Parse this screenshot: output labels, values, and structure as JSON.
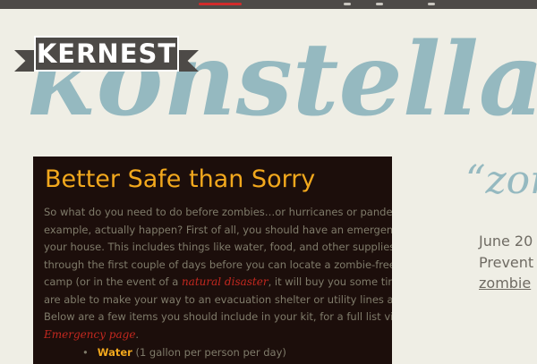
{
  "site": {
    "logo_text": "KERNEST",
    "script_title": "konstellation"
  },
  "post": {
    "title": "Better Safe than Sorry",
    "lines": [
      "So what do you need to do before zombies…or hurricanes or pander",
      "example, actually happen? First of all, you should have an emergen",
      "your house. This includes things like water, food, and other supplies",
      "through the first couple of days before you can locate a zombie-free",
      "camp (or in the event of a ",
      "are able to make your way to an evacuation shelter or utility lines are",
      "Below are a few items you should include in your kit, for a full list vis"
    ],
    "natural_disaster_link": "natural disaster",
    "camp_line_suffix": ", it will buy you some time",
    "emergency_link": "Emergency page",
    "emergency_suffix": ".",
    "list_item_bold": "Water",
    "list_item_rest": " (1 gallon per person per day)"
  },
  "sidebar": {
    "quote": "“zom",
    "date": "June 20",
    "category": "Prevent",
    "link": "zombie"
  },
  "colors": {
    "accent_blue": "#95b9c0",
    "title_orange": "#f2a81d",
    "link_red": "#c3281f",
    "card_bg": "#1c0e0b",
    "page_bg": "#efeee5"
  }
}
